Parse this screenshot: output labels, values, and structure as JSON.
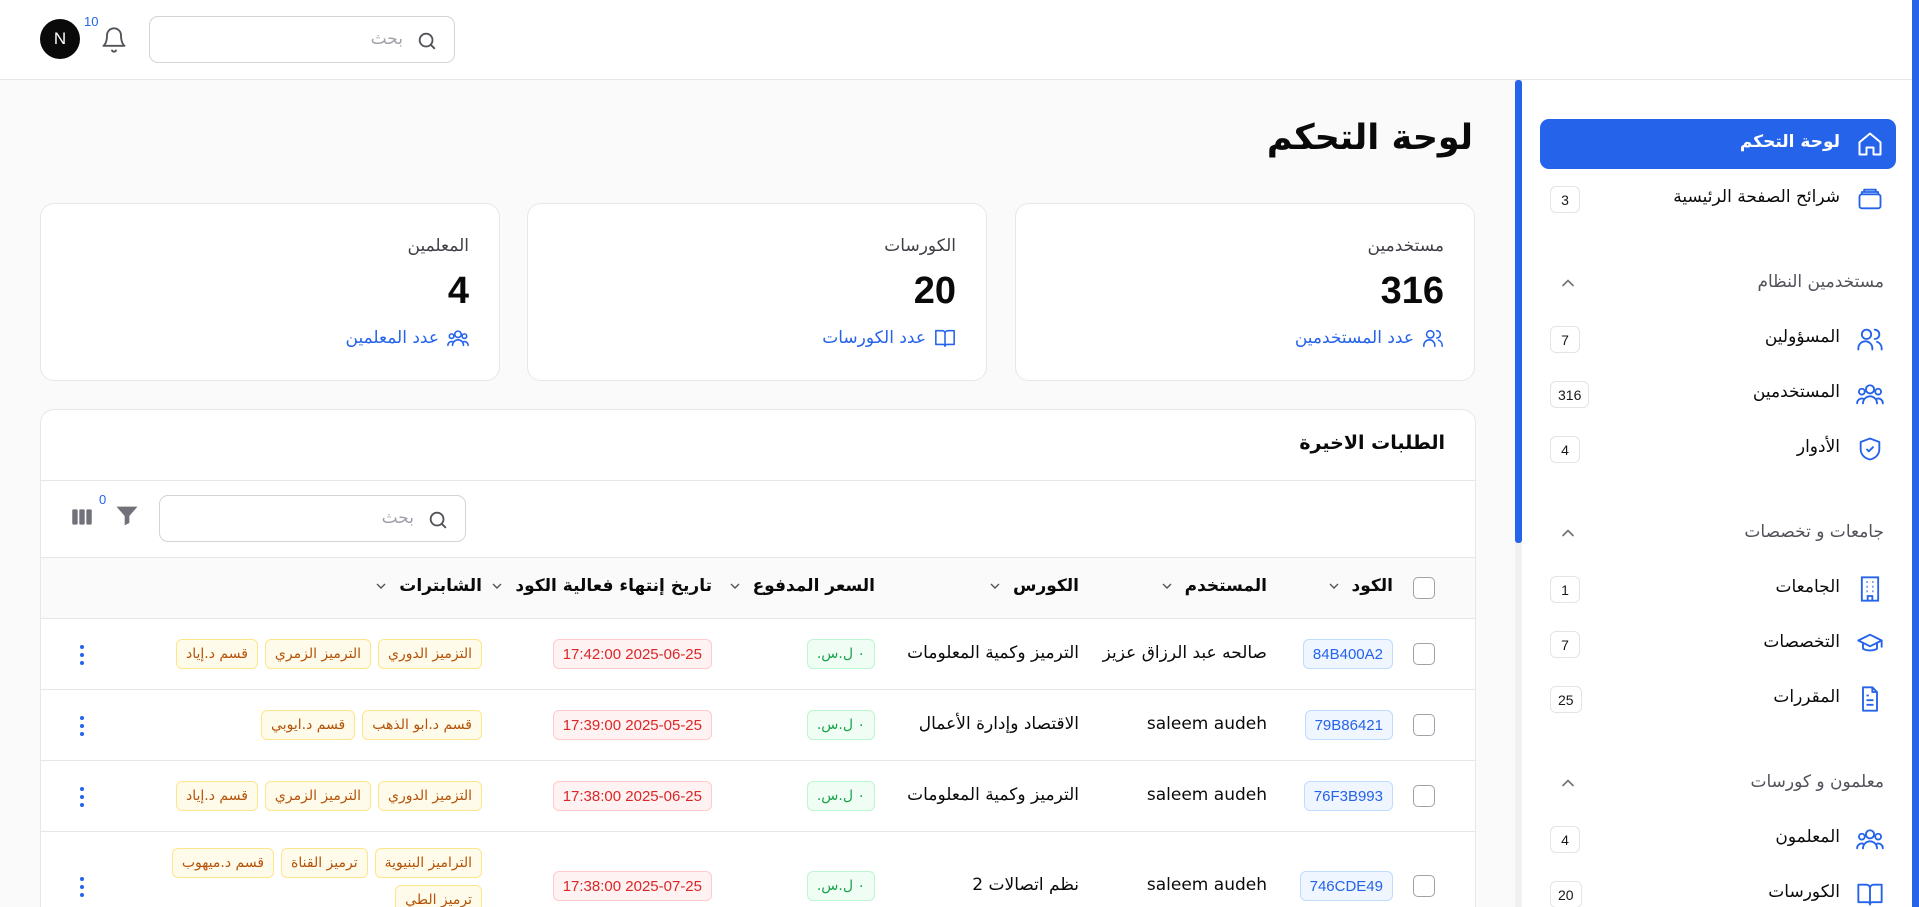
{
  "header": {
    "avatar_initial": "N",
    "notifications_count": "10",
    "search_placeholder": "بحث"
  },
  "sidebar": {
    "items_top": [
      {
        "label": "لوحة التحكم",
        "icon": "home-icon",
        "active": true
      },
      {
        "label": "شرائح الصفحة الرئيسية",
        "icon": "layers-icon",
        "count": "3"
      }
    ],
    "groups": [
      {
        "title": "مستخدمين النظام",
        "items": [
          {
            "label": "المسؤولين",
            "icon": "users-icon",
            "count": "7"
          },
          {
            "label": "المستخدمين",
            "icon": "users-group-icon",
            "count": "316"
          },
          {
            "label": "الأدوار",
            "icon": "shield-check-icon",
            "count": "4"
          }
        ]
      },
      {
        "title": "جامعات و تخصصات",
        "items": [
          {
            "label": "الجامعات",
            "icon": "building-icon",
            "count": "1"
          },
          {
            "label": "التخصصات",
            "icon": "graduation-cap-icon",
            "count": "7"
          },
          {
            "label": "المقررات",
            "icon": "file-text-icon",
            "count": "25"
          }
        ]
      },
      {
        "title": "معلمون و كورسات",
        "items": [
          {
            "label": "المعلمون",
            "icon": "users-group-icon",
            "count": "4"
          },
          {
            "label": "الكورسات",
            "icon": "book-open-icon",
            "count": "20"
          }
        ]
      }
    ]
  },
  "main": {
    "title": "لوحة التحكم",
    "stats": [
      {
        "title": "مستخدمين",
        "value": "316",
        "link": "عدد المستخدمين",
        "icon": "users-icon"
      },
      {
        "title": "الكورسات",
        "value": "20",
        "link": "عدد الكورسات",
        "icon": "book-open-icon"
      },
      {
        "title": "المعلمين",
        "value": "4",
        "link": "عدد المعلمين",
        "icon": "users-group-icon"
      }
    ],
    "orders": {
      "title": "الطلبات الاخيرة",
      "search_placeholder": "بحث",
      "filter_count": "0",
      "columns": [
        "الكود",
        "المستخدم",
        "الكورس",
        "السعر المدفوع",
        "تاريخ إنتهاء فعالية الكود",
        "الشابترات"
      ],
      "rows": [
        {
          "code": "84B400A2",
          "user": "صالحه عبد الرزاق عزيز",
          "course": "الترميز وكمية المعلومات",
          "price": "٠ ل.س.",
          "expiry": "2025-06-25 17:42:00",
          "chapters": [
            "التزميز الدوري",
            "الترميز الزمري",
            "قسم د.إياد"
          ]
        },
        {
          "code": "79B86421",
          "user": "saleem audeh",
          "course": "الاقتصاد وإدارة الأعمال",
          "price": "٠ ل.س.",
          "expiry": "2025-05-25 17:39:00",
          "chapters": [
            "قسم د.ابو الذهب",
            "قسم د.ايوبي"
          ]
        },
        {
          "code": "76F3B993",
          "user": "saleem audeh",
          "course": "الترميز وكمية المعلومات",
          "price": "٠ ل.س.",
          "expiry": "2025-06-25 17:38:00",
          "chapters": [
            "التزميز الدوري",
            "الترميز الزمري",
            "قسم د.إياد"
          ]
        },
        {
          "code": "746CDE49",
          "user": "saleem audeh",
          "course": "نظم اتصالات 2",
          "price": "٠ ل.س.",
          "expiry": "2025-07-25 17:38:00",
          "chapters": [
            "التراميز البنيوية",
            "ترميز القناة",
            "قسم د.ميهوب",
            "ترميز الطي"
          ]
        }
      ]
    }
  },
  "colors": {
    "accent": "#2563eb",
    "price_green": "#16a34a",
    "date_red": "#dc2626",
    "tag_amber": "#b45309"
  }
}
